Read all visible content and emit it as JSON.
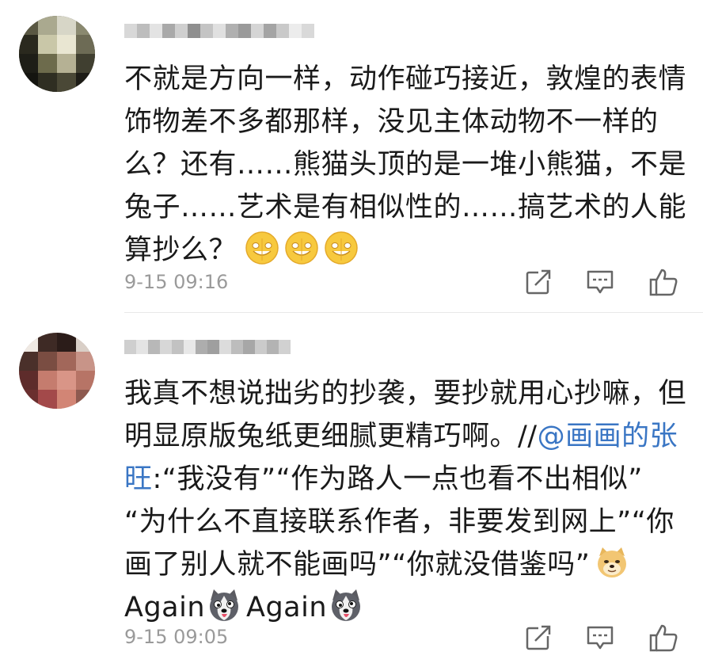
{
  "comments": [
    {
      "username_hidden": true,
      "lines": [
        "不就是方向一样，动作碰巧接近，敦煌的表情",
        "饰物差不多都那样，没见主体动物不一样的",
        "么？还有……熊猫头顶的是一堆小熊猫，不是",
        "兔子……艺术是有相似性的……搞艺术的人能",
        "算抄么？"
      ],
      "emoji": [
        "grin-emoji",
        "grin-emoji",
        "grin-emoji"
      ],
      "timestamp": "9-15 09:16",
      "actions": [
        "share-icon",
        "comment-icon",
        "like-icon"
      ]
    },
    {
      "username_hidden": true,
      "line1": "我真不想说拙劣的抄袭，要抄就用心抄嘛，但",
      "line2_text": "明显原版兔纸更细腻更精巧啊。//",
      "line2_mention": "@画画的张",
      "line3_mention": "旺",
      "line3_text": ":“我没有”“作为路人一点也看不出相似”",
      "line4": "“为什么不直接联系作者，非要发到网上”“你",
      "line5": "画了别人就不能画吗”“你就没借鉴吗”",
      "again1": "Again",
      "again2": "Again",
      "timestamp": "9-15 09:05",
      "actions": [
        "share-icon",
        "comment-icon",
        "like-icon"
      ]
    }
  ],
  "colors": {
    "text": "#1a1a1a",
    "mention": "#3a76c4",
    "muted": "#9a9a9a",
    "emoji_yellow": "#f7c93e"
  }
}
